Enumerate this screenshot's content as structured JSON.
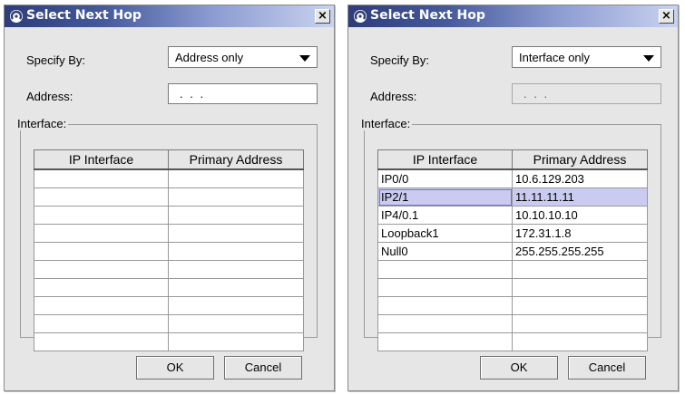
{
  "dialogs": [
    {
      "title": "Select Next Hop",
      "close_label": "×",
      "specify_label": "Specify By:",
      "specify_value": "Address only",
      "address_label": "Address:",
      "address_value": ". . .",
      "address_enabled": true,
      "interface_label": "Interface:",
      "table": {
        "headers": [
          "IP Interface",
          "Primary Address"
        ],
        "rows": [
          [
            "",
            ""
          ],
          [
            "",
            ""
          ],
          [
            "",
            ""
          ],
          [
            "",
            ""
          ],
          [
            "",
            ""
          ],
          [
            "",
            ""
          ],
          [
            "",
            ""
          ],
          [
            "",
            ""
          ],
          [
            "",
            ""
          ],
          [
            "",
            ""
          ]
        ],
        "selected_row": -1
      },
      "ok_label": "OK",
      "cancel_label": "Cancel"
    },
    {
      "title": "Select Next Hop",
      "close_label": "×",
      "specify_label": "Specify By:",
      "specify_value": "Interface only",
      "address_label": "Address:",
      "address_value": ". . .",
      "address_enabled": false,
      "interface_label": "Interface:",
      "table": {
        "headers": [
          "IP Interface",
          "Primary Address"
        ],
        "rows": [
          [
            "IP0/0",
            "10.6.129.203"
          ],
          [
            "IP2/1",
            "11.11.11.11"
          ],
          [
            "IP4/0.1",
            "10.10.10.10"
          ],
          [
            "Loopback1",
            "172.31.1.8"
          ],
          [
            "Null0",
            "255.255.255.255"
          ],
          [
            "",
            ""
          ],
          [
            "",
            ""
          ],
          [
            "",
            ""
          ],
          [
            "",
            ""
          ],
          [
            "",
            ""
          ]
        ],
        "selected_row": 1
      },
      "ok_label": "OK",
      "cancel_label": "Cancel"
    }
  ],
  "colors": {
    "titlebar_start": "#2e3d79",
    "titlebar_end": "#c9d2ef",
    "dialog_bg": "#e6e6e6",
    "selected_row": "#cbcbf1"
  }
}
